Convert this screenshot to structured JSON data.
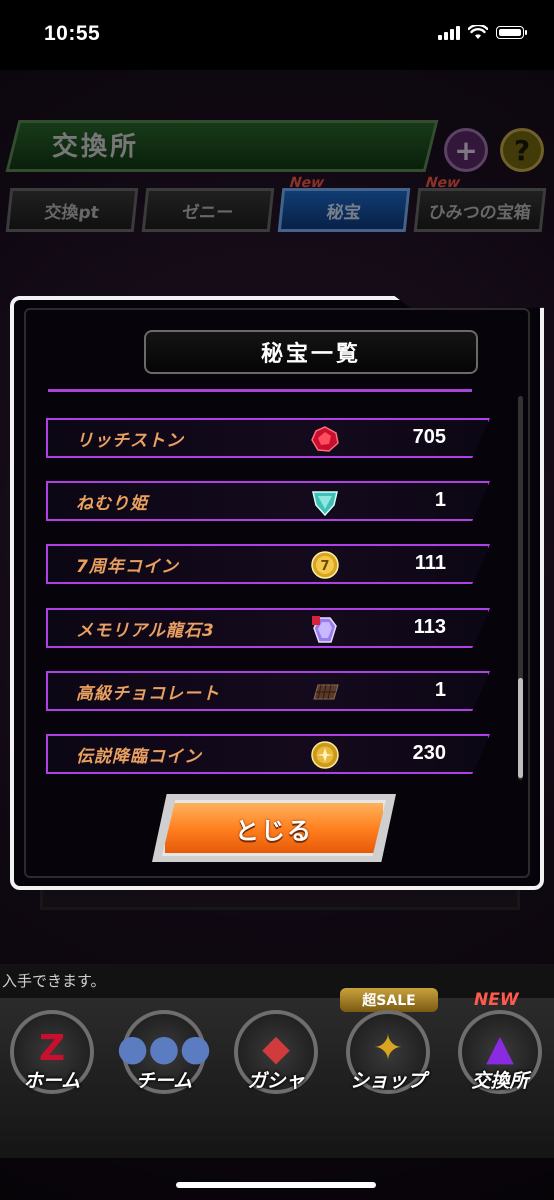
{
  "status_bar": {
    "time": "10:55"
  },
  "header": {
    "title": "交換所"
  },
  "tabs": [
    {
      "label": "交換pt",
      "new": ""
    },
    {
      "label": "ゼニー",
      "new": ""
    },
    {
      "label": "秘宝",
      "new": "New"
    },
    {
      "label": "ひみつの宝箱",
      "new": "New"
    }
  ],
  "modal": {
    "title": "秘宝一覧",
    "items": [
      {
        "name": "リッチストン",
        "icon": "red-gem-icon",
        "count": "705"
      },
      {
        "name": "ねむり姫",
        "icon": "teal-shield-gem-icon",
        "count": "1"
      },
      {
        "name": "7周年コイン",
        "icon": "gold-7-coin-icon",
        "count": "111"
      },
      {
        "name": "メモリアル龍石3",
        "icon": "purple-crystal-icon",
        "count": "113"
      },
      {
        "name": "高級チョコレート",
        "icon": "chocolate-bar-icon",
        "count": "1"
      },
      {
        "name": "伝説降臨コイン",
        "icon": "gold-coin-icon",
        "count": "230"
      }
    ],
    "close_label": "とじる"
  },
  "hint": "入手できます。",
  "nav": {
    "sale_badge": "超SALE",
    "new_badge": "NEW",
    "items": [
      {
        "label": "ホーム",
        "icon": "z-icon"
      },
      {
        "label": "チーム",
        "icon": "team-icon"
      },
      {
        "label": "ガシャ",
        "icon": "gasha-icon"
      },
      {
        "label": "ショップ",
        "icon": "shop-icon"
      },
      {
        "label": "交換所",
        "icon": "exchange-icon"
      }
    ]
  },
  "colors": {
    "accent_purple": "#b13fe6",
    "item_name": "#e9a060",
    "close_button": "#ff7d1c"
  }
}
